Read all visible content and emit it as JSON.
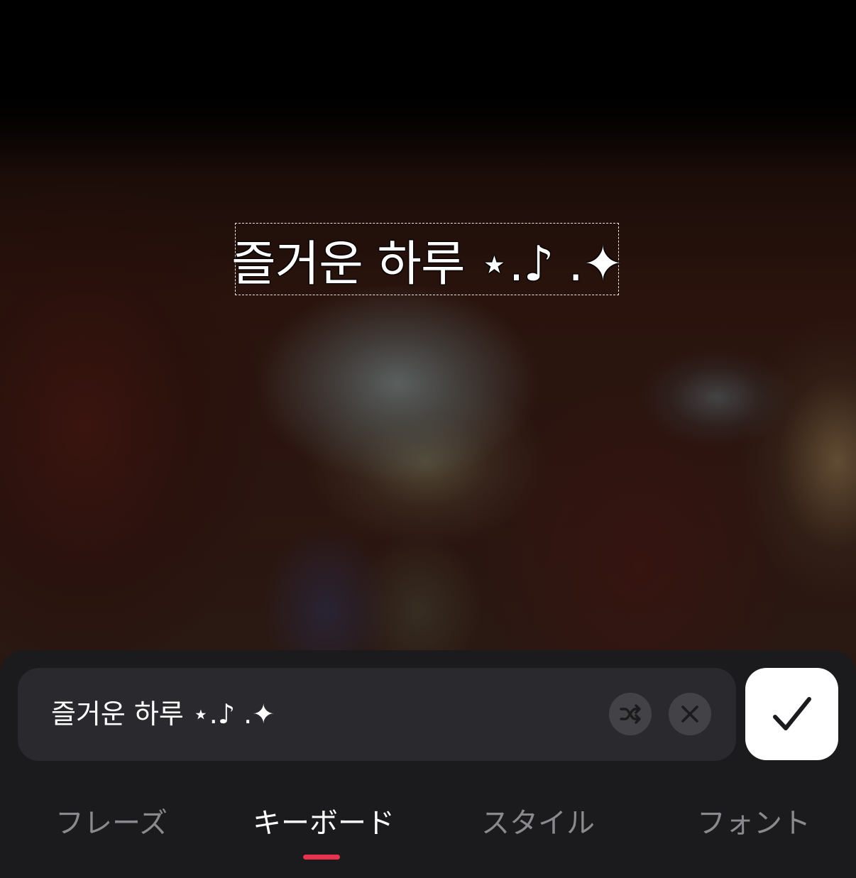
{
  "photo": {
    "overlay_text": "즐거운 하루  ⋆.♪ .✦"
  },
  "editor": {
    "input_value": "즐거운 하루  ⋆.♪ .✦",
    "shuffle_icon": "shuffle-icon",
    "clear_icon": "close-icon",
    "confirm_icon": "checkmark-icon"
  },
  "tabs": [
    {
      "label": "フレーズ",
      "active": false
    },
    {
      "label": "キーボード",
      "active": true
    },
    {
      "label": "スタイル",
      "active": false
    },
    {
      "label": "フォント",
      "active": false
    }
  ],
  "colors": {
    "accent": "#e8334f",
    "panel": "#1b1b1d",
    "input_bg": "#2a2a2e"
  }
}
